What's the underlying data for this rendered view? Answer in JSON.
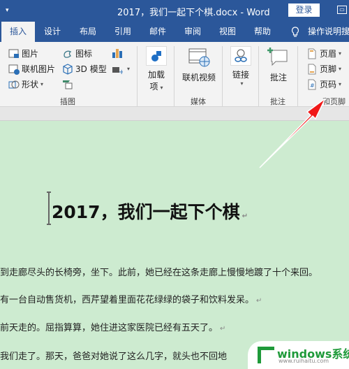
{
  "window": {
    "title": "2017，我们一起下个棋.docx  -  Word",
    "login_label": "登录",
    "quick_access_icon": "customize-quick-access-icon",
    "restore_icon": "ribbon-display-options-icon"
  },
  "tabs": [
    {
      "label": "插入",
      "active": true
    },
    {
      "label": "设计"
    },
    {
      "label": "布局"
    },
    {
      "label": "引用"
    },
    {
      "label": "邮件"
    },
    {
      "label": "审阅"
    },
    {
      "label": "视图"
    },
    {
      "label": "帮助"
    }
  ],
  "tell_me": {
    "label": "操作说明搜",
    "icon": "lightbulb-icon"
  },
  "ribbon": {
    "illustrations": {
      "label": "插图",
      "items": [
        {
          "label": "图片",
          "icon": "picture-icon"
        },
        {
          "label": "联机图片",
          "icon": "online-picture-icon"
        },
        {
          "label": "形状",
          "icon": "shapes-icon",
          "dropdown": true
        },
        {
          "label": "图标",
          "icon": "icons-icon"
        },
        {
          "label": "3D 模型",
          "icon": "3d-model-icon"
        },
        {
          "label": "",
          "icon": "smartart-icon"
        },
        {
          "label": "",
          "icon": "chart-icon"
        },
        {
          "label": "",
          "icon": "screenshot-icon",
          "dropdown": true
        }
      ]
    },
    "addins": {
      "label": "加载项",
      "line1": "加载",
      "line2": "项",
      "icon": "addins-icon"
    },
    "media": {
      "label": "媒体",
      "items": [
        {
          "label": "联机视频",
          "icon": "online-video-icon"
        }
      ]
    },
    "links": {
      "label": "链接",
      "icon": "link-icon"
    },
    "comments": {
      "label": "批注",
      "items": [
        {
          "label": "批注",
          "icon": "comment-icon"
        }
      ]
    },
    "header_footer": {
      "label": "页眉和页脚",
      "label_visible": "和页脚",
      "items": [
        {
          "label": "页眉",
          "icon": "header-icon"
        },
        {
          "label": "页脚",
          "icon": "footer-icon"
        },
        {
          "label": "页码",
          "icon": "page-number-icon"
        }
      ]
    }
  },
  "document": {
    "heading": "2017，我们一起下个棋",
    "paragraphs": [
      "到走廊尽头的长椅旁，坐下。此前，她已经在这条走廊上慢慢地踱了十个来回。",
      "有一台自动售货机，西芹望着里面花花绿绿的袋子和饮料发呆。",
      "前天走的。屈指算算，她住进这家医院已经有五天了。",
      "我们走了。那天，爸爸对她说了这么几字，就头也不回地"
    ],
    "paragraph_mark": "↵"
  },
  "watermark": {
    "title": "windows系统家园",
    "url": "www.ruihaitu.com"
  },
  "annotation": {
    "type": "red-arrow",
    "target": "page-number-button"
  }
}
